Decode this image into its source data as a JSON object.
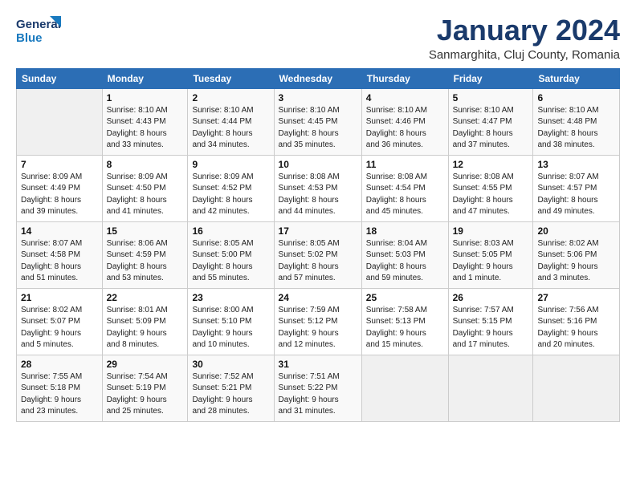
{
  "logo": {
    "line1": "General",
    "line2": "Blue"
  },
  "title": "January 2024",
  "subtitle": "Sanmarghita, Cluj County, Romania",
  "days_of_week": [
    "Sunday",
    "Monday",
    "Tuesday",
    "Wednesday",
    "Thursday",
    "Friday",
    "Saturday"
  ],
  "weeks": [
    [
      {
        "num": "",
        "info": ""
      },
      {
        "num": "1",
        "info": "Sunrise: 8:10 AM\nSunset: 4:43 PM\nDaylight: 8 hours\nand 33 minutes."
      },
      {
        "num": "2",
        "info": "Sunrise: 8:10 AM\nSunset: 4:44 PM\nDaylight: 8 hours\nand 34 minutes."
      },
      {
        "num": "3",
        "info": "Sunrise: 8:10 AM\nSunset: 4:45 PM\nDaylight: 8 hours\nand 35 minutes."
      },
      {
        "num": "4",
        "info": "Sunrise: 8:10 AM\nSunset: 4:46 PM\nDaylight: 8 hours\nand 36 minutes."
      },
      {
        "num": "5",
        "info": "Sunrise: 8:10 AM\nSunset: 4:47 PM\nDaylight: 8 hours\nand 37 minutes."
      },
      {
        "num": "6",
        "info": "Sunrise: 8:10 AM\nSunset: 4:48 PM\nDaylight: 8 hours\nand 38 minutes."
      }
    ],
    [
      {
        "num": "7",
        "info": "Sunrise: 8:09 AM\nSunset: 4:49 PM\nDaylight: 8 hours\nand 39 minutes."
      },
      {
        "num": "8",
        "info": "Sunrise: 8:09 AM\nSunset: 4:50 PM\nDaylight: 8 hours\nand 41 minutes."
      },
      {
        "num": "9",
        "info": "Sunrise: 8:09 AM\nSunset: 4:52 PM\nDaylight: 8 hours\nand 42 minutes."
      },
      {
        "num": "10",
        "info": "Sunrise: 8:08 AM\nSunset: 4:53 PM\nDaylight: 8 hours\nand 44 minutes."
      },
      {
        "num": "11",
        "info": "Sunrise: 8:08 AM\nSunset: 4:54 PM\nDaylight: 8 hours\nand 45 minutes."
      },
      {
        "num": "12",
        "info": "Sunrise: 8:08 AM\nSunset: 4:55 PM\nDaylight: 8 hours\nand 47 minutes."
      },
      {
        "num": "13",
        "info": "Sunrise: 8:07 AM\nSunset: 4:57 PM\nDaylight: 8 hours\nand 49 minutes."
      }
    ],
    [
      {
        "num": "14",
        "info": "Sunrise: 8:07 AM\nSunset: 4:58 PM\nDaylight: 8 hours\nand 51 minutes."
      },
      {
        "num": "15",
        "info": "Sunrise: 8:06 AM\nSunset: 4:59 PM\nDaylight: 8 hours\nand 53 minutes."
      },
      {
        "num": "16",
        "info": "Sunrise: 8:05 AM\nSunset: 5:00 PM\nDaylight: 8 hours\nand 55 minutes."
      },
      {
        "num": "17",
        "info": "Sunrise: 8:05 AM\nSunset: 5:02 PM\nDaylight: 8 hours\nand 57 minutes."
      },
      {
        "num": "18",
        "info": "Sunrise: 8:04 AM\nSunset: 5:03 PM\nDaylight: 8 hours\nand 59 minutes."
      },
      {
        "num": "19",
        "info": "Sunrise: 8:03 AM\nSunset: 5:05 PM\nDaylight: 9 hours\nand 1 minute."
      },
      {
        "num": "20",
        "info": "Sunrise: 8:02 AM\nSunset: 5:06 PM\nDaylight: 9 hours\nand 3 minutes."
      }
    ],
    [
      {
        "num": "21",
        "info": "Sunrise: 8:02 AM\nSunset: 5:07 PM\nDaylight: 9 hours\nand 5 minutes."
      },
      {
        "num": "22",
        "info": "Sunrise: 8:01 AM\nSunset: 5:09 PM\nDaylight: 9 hours\nand 8 minutes."
      },
      {
        "num": "23",
        "info": "Sunrise: 8:00 AM\nSunset: 5:10 PM\nDaylight: 9 hours\nand 10 minutes."
      },
      {
        "num": "24",
        "info": "Sunrise: 7:59 AM\nSunset: 5:12 PM\nDaylight: 9 hours\nand 12 minutes."
      },
      {
        "num": "25",
        "info": "Sunrise: 7:58 AM\nSunset: 5:13 PM\nDaylight: 9 hours\nand 15 minutes."
      },
      {
        "num": "26",
        "info": "Sunrise: 7:57 AM\nSunset: 5:15 PM\nDaylight: 9 hours\nand 17 minutes."
      },
      {
        "num": "27",
        "info": "Sunrise: 7:56 AM\nSunset: 5:16 PM\nDaylight: 9 hours\nand 20 minutes."
      }
    ],
    [
      {
        "num": "28",
        "info": "Sunrise: 7:55 AM\nSunset: 5:18 PM\nDaylight: 9 hours\nand 23 minutes."
      },
      {
        "num": "29",
        "info": "Sunrise: 7:54 AM\nSunset: 5:19 PM\nDaylight: 9 hours\nand 25 minutes."
      },
      {
        "num": "30",
        "info": "Sunrise: 7:52 AM\nSunset: 5:21 PM\nDaylight: 9 hours\nand 28 minutes."
      },
      {
        "num": "31",
        "info": "Sunrise: 7:51 AM\nSunset: 5:22 PM\nDaylight: 9 hours\nand 31 minutes."
      },
      {
        "num": "",
        "info": ""
      },
      {
        "num": "",
        "info": ""
      },
      {
        "num": "",
        "info": ""
      }
    ]
  ]
}
